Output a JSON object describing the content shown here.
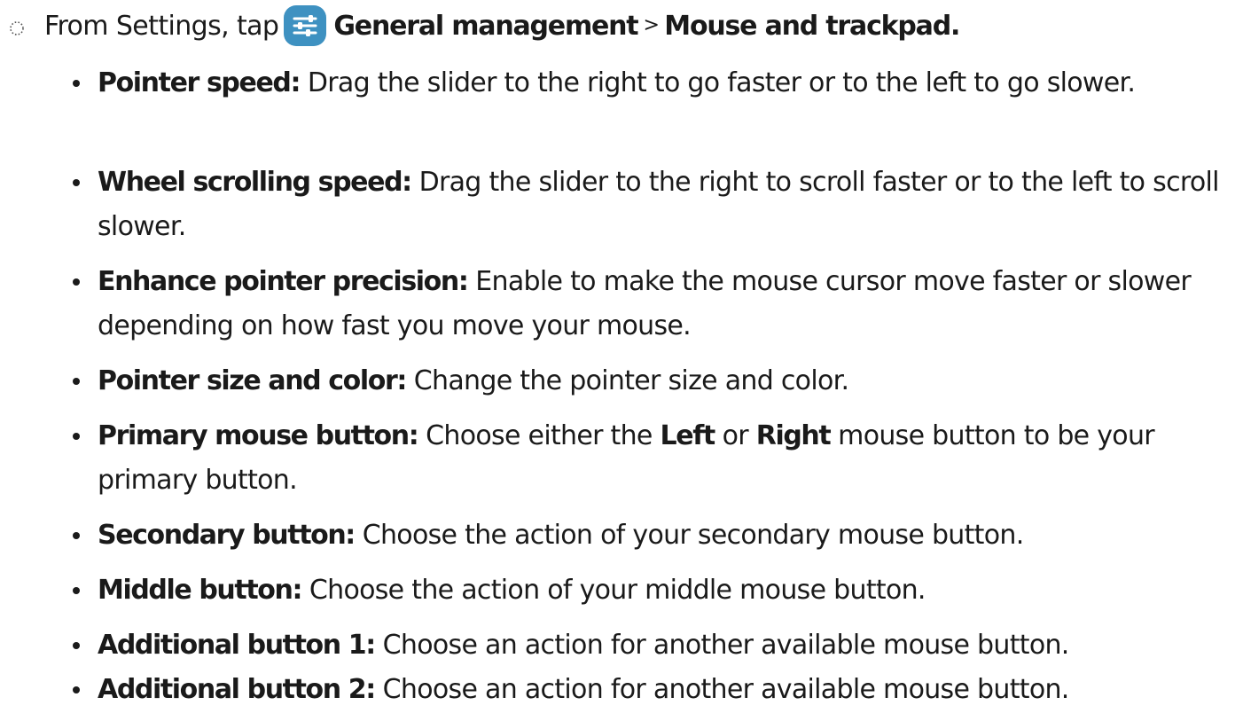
{
  "step": {
    "prefix": "From Settings, tap",
    "icon": "settings-sliders-icon",
    "icon_color": "#3e91c1",
    "path_1": "General management",
    "separator": ">",
    "path_2": "Mouse and trackpad."
  },
  "items": [
    {
      "term": "Pointer speed:",
      "description": " Drag the slider to the right to go faster or to the left to go slower."
    },
    {
      "term": "Wheel scrolling speed:",
      "description": " Drag the slider to the right to scroll faster or to the left to scroll slower."
    },
    {
      "term": "Enhance pointer precision:",
      "description": " Enable to make the mouse cursor move faster or slower depending on how fast you move your mouse."
    },
    {
      "term": "Pointer size and color:",
      "description": " Change the pointer size and color."
    },
    {
      "term": "Primary mouse button:",
      "description_1": " Choose either the ",
      "option_left": "Left",
      "or": " or ",
      "option_right": "Right",
      "description_2": " mouse button to be your primary button."
    },
    {
      "term": "Secondary button:",
      "description": " Choose the action of your secondary mouse button."
    },
    {
      "term": "Middle button:",
      "description": " Choose the action of your middle mouse button."
    },
    {
      "term": "Additional button 1:",
      "description": " Choose an action for another available mouse button."
    },
    {
      "term": "Additional button 2:",
      "description": " Choose an action for another available mouse button."
    }
  ]
}
